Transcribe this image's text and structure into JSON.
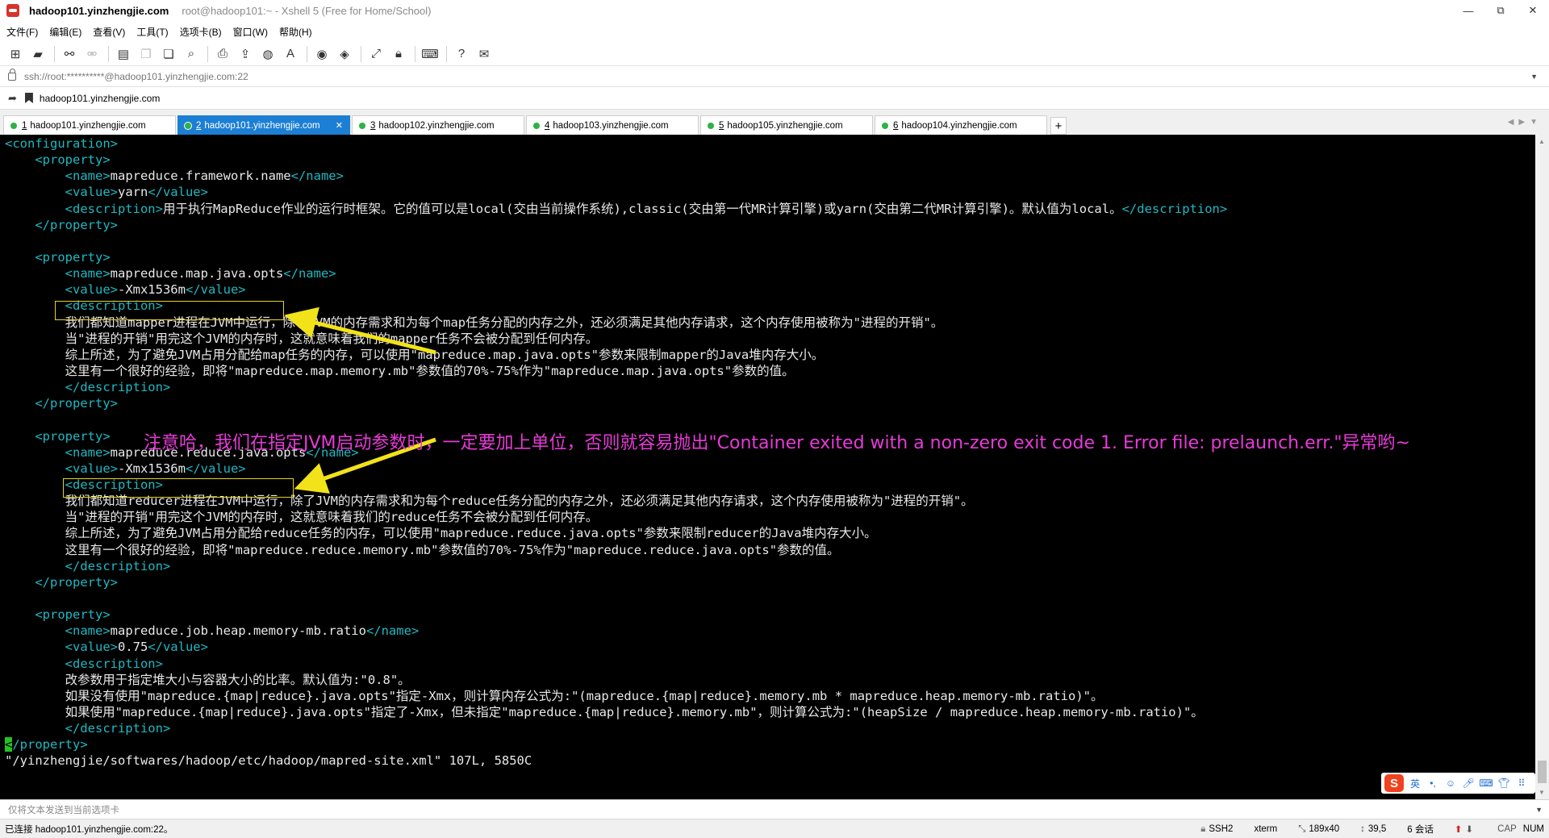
{
  "window": {
    "title": "hadoop101.yinzhengjie.com",
    "subtitle": "root@hadoop101:~ - Xshell 5 (Free for Home/School)",
    "buttons": [
      "—",
      "⧉",
      "✕"
    ]
  },
  "menu": [
    "文件(F)",
    "编辑(E)",
    "查看(V)",
    "工具(T)",
    "选项卡(B)",
    "窗口(W)",
    "帮助(H)"
  ],
  "address": {
    "value": "ssh://root:**********@hadoop101.yinzhengjie.com:22"
  },
  "bookmark": {
    "label": "hadoop101.yinzhengjie.com"
  },
  "tabs": [
    {
      "num": "1",
      "label": "hadoop101.yinzhengjie.com",
      "active": false
    },
    {
      "num": "2",
      "label": "hadoop101.yinzhengjie.com",
      "active": true
    },
    {
      "num": "3",
      "label": "hadoop102.yinzhengjie.com",
      "active": false
    },
    {
      "num": "4",
      "label": "hadoop103.yinzhengjie.com",
      "active": false
    },
    {
      "num": "5",
      "label": "hadoop105.yinzhengjie.com",
      "active": false
    },
    {
      "num": "6",
      "label": "hadoop104.yinzhengjie.com",
      "active": false
    }
  ],
  "terminal": {
    "lines": [
      [
        {
          "t": "tag",
          "s": "<configuration>"
        }
      ],
      [
        {
          "t": "tag",
          "s": "    <property>"
        }
      ],
      [
        {
          "t": "tag",
          "s": "        <name>"
        },
        {
          "t": "txt",
          "s": "mapreduce.framework.name"
        },
        {
          "t": "tag",
          "s": "</name>"
        }
      ],
      [
        {
          "t": "tag",
          "s": "        <value>"
        },
        {
          "t": "txt",
          "s": "yarn"
        },
        {
          "t": "tag",
          "s": "</value>"
        }
      ],
      [
        {
          "t": "tag",
          "s": "        <description>"
        },
        {
          "t": "txt",
          "s": "用于执行MapReduce作业的运行时框架。它的值可以是local(交由当前操作系统),classic(交由第一代MR计算引擎)或yarn(交由第二代MR计算引擎)。默认值为local。"
        },
        {
          "t": "tag",
          "s": "</description>"
        }
      ],
      [
        {
          "t": "tag",
          "s": "    </property>"
        }
      ],
      [],
      [
        {
          "t": "tag",
          "s": "    <property>"
        }
      ],
      [
        {
          "t": "tag",
          "s": "        <name>"
        },
        {
          "t": "txt",
          "s": "mapreduce.map.java.opts"
        },
        {
          "t": "tag",
          "s": "</name>"
        }
      ],
      [
        {
          "t": "tag",
          "s": "        <value>"
        },
        {
          "t": "txt",
          "s": "-Xmx1536m"
        },
        {
          "t": "tag",
          "s": "</value>"
        }
      ],
      [
        {
          "t": "tag",
          "s": "        <description>"
        }
      ],
      [
        {
          "t": "txt",
          "s": "        我们都知道mapper进程在JVM中运行，除了JVM的内存需求和为每个map任务分配的内存之外，还必须满足其他内存请求，这个内存使用被称为\"进程的开销\"。"
        }
      ],
      [
        {
          "t": "txt",
          "s": "        当\"进程的开销\"用完这个JVM的内存时，这就意味着我们的mapper任务不会被分配到任何内存。"
        }
      ],
      [
        {
          "t": "txt",
          "s": "        综上所述，为了避免JVM占用分配给map任务的内存，可以使用\"mapreduce.map.java.opts\"参数来限制mapper的Java堆内存大小。"
        }
      ],
      [
        {
          "t": "txt",
          "s": "        这里有一个很好的经验，即将\"mapreduce.map.memory.mb\"参数值的70%-75%作为\"mapreduce.map.java.opts\"参数的值。"
        }
      ],
      [
        {
          "t": "tag",
          "s": "        </description>"
        }
      ],
      [
        {
          "t": "tag",
          "s": "    </property>"
        }
      ],
      [],
      [
        {
          "t": "tag",
          "s": "    <property>"
        }
      ],
      [
        {
          "t": "tag",
          "s": "        <name>"
        },
        {
          "t": "txt",
          "s": "mapreduce.reduce.java.opts"
        },
        {
          "t": "tag",
          "s": "</name>"
        }
      ],
      [
        {
          "t": "tag",
          "s": "        <value>"
        },
        {
          "t": "txt",
          "s": "-Xmx1536m"
        },
        {
          "t": "tag",
          "s": "</value>"
        }
      ],
      [
        {
          "t": "tag",
          "s": "        <description>"
        }
      ],
      [
        {
          "t": "txt",
          "s": "        我们都知道reducer进程在JVM中运行，除了JVM的内存需求和为每个reduce任务分配的内存之外，还必须满足其他内存请求，这个内存使用被称为\"进程的开销\"。"
        }
      ],
      [
        {
          "t": "txt",
          "s": "        当\"进程的开销\"用完这个JVM的内存时，这就意味着我们的reduce任务不会被分配到任何内存。"
        }
      ],
      [
        {
          "t": "txt",
          "s": "        综上所述，为了避免JVM占用分配给reduce任务的内存，可以使用\"mapreduce.reduce.java.opts\"参数来限制reducer的Java堆内存大小。"
        }
      ],
      [
        {
          "t": "txt",
          "s": "        这里有一个很好的经验，即将\"mapreduce.reduce.memory.mb\"参数值的70%-75%作为\"mapreduce.reduce.java.opts\"参数的值。"
        }
      ],
      [
        {
          "t": "tag",
          "s": "        </description>"
        }
      ],
      [
        {
          "t": "tag",
          "s": "    </property>"
        }
      ],
      [],
      [
        {
          "t": "tag",
          "s": "    <property>"
        }
      ],
      [
        {
          "t": "tag",
          "s": "        <name>"
        },
        {
          "t": "txt",
          "s": "mapreduce.job.heap.memory-mb.ratio"
        },
        {
          "t": "tag",
          "s": "</name>"
        }
      ],
      [
        {
          "t": "tag",
          "s": "        <value>"
        },
        {
          "t": "txt",
          "s": "0.75"
        },
        {
          "t": "tag",
          "s": "</value>"
        }
      ],
      [
        {
          "t": "tag",
          "s": "        <description>"
        }
      ],
      [
        {
          "t": "txt",
          "s": "        改参数用于指定堆大小与容器大小的比率。默认值为:\"0.8\"。"
        }
      ],
      [
        {
          "t": "txt",
          "s": "        如果没有使用\"mapreduce.{map|reduce}.java.opts\"指定-Xmx，则计算内存公式为:\"(mapreduce.{map|reduce}.memory.mb * mapreduce.heap.memory-mb.ratio)\"。"
        }
      ],
      [
        {
          "t": "txt",
          "s": "        如果使用\"mapreduce.{map|reduce}.java.opts\"指定了-Xmx，但未指定\"mapreduce.{map|reduce}.memory.mb\"，则计算公式为:\"(heapSize / mapreduce.heap.memory-mb.ratio)\"。"
        }
      ],
      [
        {
          "t": "tag",
          "s": "        </description>"
        }
      ],
      [
        {
          "t": "cursor",
          "s": "<"
        },
        {
          "t": "tag",
          "s": "/property>"
        }
      ],
      [
        {
          "t": "txt",
          "s": "\"/yinzhengjie/softwares/hadoop/etc/hadoop/mapred-site.xml\" 107L, 5850C"
        }
      ]
    ],
    "annotation": "注意哈，我们在指定JVM启动参数时，一定要加上单位，否则就容易抛出\"Container exited with a non-zero exit code 1. Error file: prelaunch.err.\"异常哟~"
  },
  "ime": {
    "logo": "S",
    "mode": "英"
  },
  "sendbar": {
    "placeholder": "仅将文本发送到当前选项卡"
  },
  "status": {
    "left": "已连接 hadoop101.yinzhengjie.com:22。",
    "protocol": "SSH2",
    "term": "xterm",
    "size": "189x40",
    "cursor": "39,5",
    "sessions": "6 会话",
    "caps": "CAP",
    "num": "NUM"
  },
  "colors": {
    "terminal_bg": "#000000",
    "tag": "#1fb8c2",
    "text": "#e8e8e8",
    "annotation": "#e83ad8",
    "highlight": "#e9d31c",
    "active_tab": "#1c7fd4"
  }
}
